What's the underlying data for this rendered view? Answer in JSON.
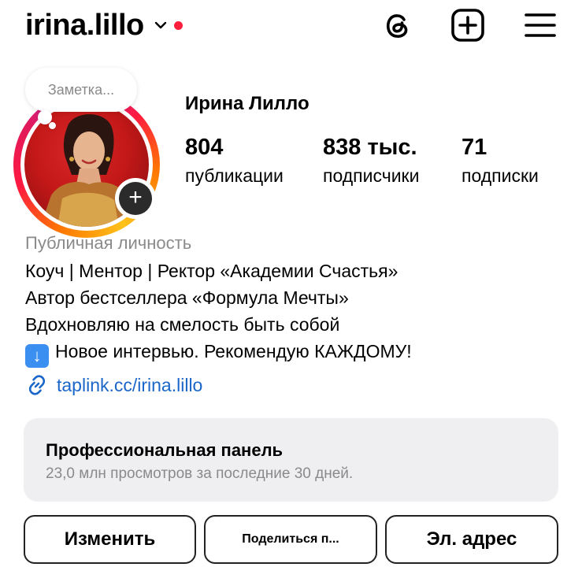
{
  "header": {
    "username": "irina.lillo",
    "icons": [
      "threads-icon",
      "new-post-icon",
      "menu-icon"
    ]
  },
  "note": {
    "text": "Заметка..."
  },
  "profile": {
    "full_name": "Ирина Лилло",
    "stats": [
      {
        "value": "804",
        "label": "публикации"
      },
      {
        "value": "838 тыс.",
        "label": "подписчики"
      },
      {
        "value": "71",
        "label": "подписки"
      }
    ]
  },
  "bio": {
    "category": "Публичная личность",
    "lines": [
      "Коуч | Ментор | Ректор «Академии Счастья»",
      "Автор бестселлера «Формула Мечты»",
      "Вдохновляю на смелость быть собой",
      "Новое интервью. Рекомендую КАЖДОМУ!"
    ],
    "link": "taplink.cc/irina.lillo"
  },
  "dashboard": {
    "title": "Профессиональная панель",
    "subtitle": "23,0 млн просмотров за последние 30 дней."
  },
  "actions": {
    "edit": "Изменить",
    "share": "Поделиться п...",
    "email": "Эл. адрес"
  },
  "colors": {
    "link": "#1a66c9",
    "notification_dot": "#ff1f3d",
    "panel_bg": "#efeff2"
  }
}
